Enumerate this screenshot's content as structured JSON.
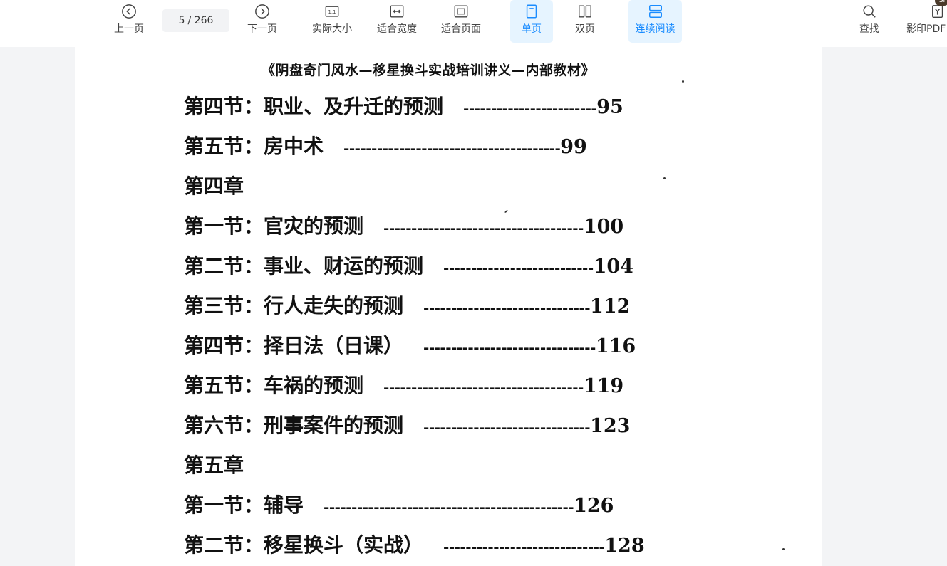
{
  "toolbar": {
    "prev_label": "上一页",
    "page_current": "5",
    "page_total": "/ 266",
    "next_label": "下一页",
    "actual_size_label": "实际大小",
    "fit_width_label": "适合宽度",
    "fit_page_label": "适合页面",
    "single_page_label": "单页",
    "double_page_label": "双页",
    "continuous_label": "连续阅读",
    "search_label": "查找",
    "print_label": "影印PDF",
    "print_badge": "SI",
    "accent_color": "#1a8cff",
    "active_bg": "#e6f4ff"
  },
  "document": {
    "header": "《阴盘奇门风水—移星换斗实战培训讲义—内部教材》",
    "entries": [
      {
        "text": "第四节：职业、及升迁的预测",
        "dashes": "------------------------",
        "page": "95"
      },
      {
        "text": "第五节：房中术",
        "dashes": "---------------------------------------",
        "page": "99"
      },
      {
        "text": "第四章",
        "dashes": "",
        "page": ""
      },
      {
        "text": "第一节：官灾的预测",
        "dashes": "------------------------------------",
        "page": "100"
      },
      {
        "text": "第二节：事业、财运的预测",
        "dashes": "---------------------------",
        "page": "104"
      },
      {
        "text": "第三节：行人走失的预测",
        "dashes": "------------------------------",
        "page": "112"
      },
      {
        "text": "第四节：择日法（日课）",
        "dashes": "-------------------------------",
        "page": "116"
      },
      {
        "text": "第五节：车祸的预测",
        "dashes": "------------------------------------",
        "page": "119"
      },
      {
        "text": "第六节：刑事案件的预测",
        "dashes": "------------------------------",
        "page": "123"
      },
      {
        "text": "第五章",
        "dashes": "",
        "page": ""
      },
      {
        "text": "第一节：辅导",
        "dashes": "---------------------------------------------",
        "page": "126"
      },
      {
        "text": "第二节：移星换斗（实战）",
        "dashes": "-----------------------------",
        "page": "128"
      }
    ]
  }
}
